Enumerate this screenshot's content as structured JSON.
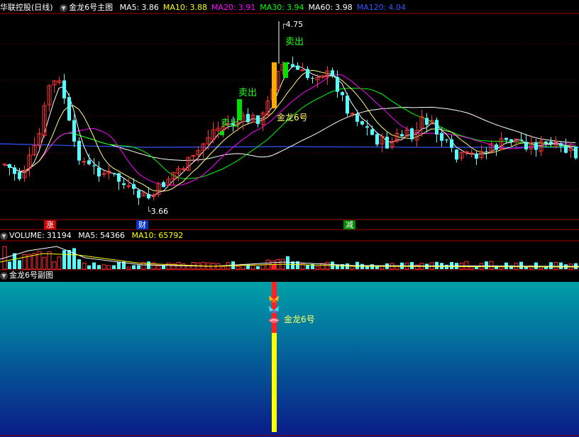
{
  "stock": {
    "name": "华联控股",
    "period": "(日线)"
  },
  "main_indicator": {
    "name": "金龙6号主图",
    "ma": [
      {
        "label": "MA5:",
        "value": "3.86",
        "color": "#ffffff"
      },
      {
        "label": "MA10:",
        "value": "3.88",
        "color": "#ffff00"
      },
      {
        "label": "MA20:",
        "value": "3.91",
        "color": "#ff00ff"
      },
      {
        "label": "MA30:",
        "value": "3.94",
        "color": "#00ff00"
      },
      {
        "label": "MA60:",
        "value": "3.98",
        "color": "#ffffff"
      },
      {
        "label": "MA120:",
        "value": "4.04",
        "color": "#3355ff"
      }
    ],
    "high_label": "4.75",
    "low_label": "3.66",
    "sell_labels": [
      "卖出",
      "卖出",
      "卖出"
    ],
    "signal_label": "金龙6号",
    "tags": [
      {
        "text": "涨",
        "color": "#cc0000"
      },
      {
        "text": "财",
        "color": "#0033cc"
      },
      {
        "text": "减",
        "color": "#008800"
      }
    ]
  },
  "volume": {
    "name": "VOLUME:",
    "value": "31194",
    "ma5_label": "MA5:",
    "ma5": "54366",
    "ma10_label": "MA10:",
    "ma10": "65792"
  },
  "sub_indicator": {
    "name": "金龙6号副图",
    "signal_label": "金龙6号"
  },
  "colors": {
    "up": "#ff3232",
    "down": "#54ffff",
    "grid": "#7a0000",
    "frame": "#a00000"
  },
  "icons": [
    "chevron-down-icon",
    "butterfly-icon",
    "fish-icon"
  ]
}
